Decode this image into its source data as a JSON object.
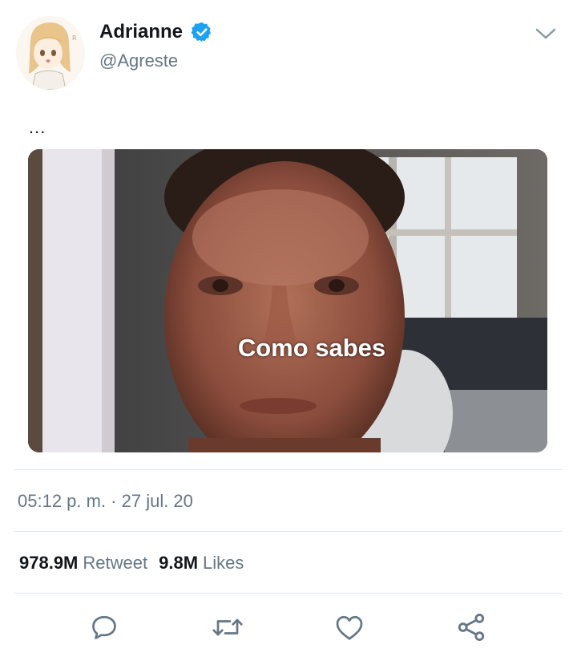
{
  "author": {
    "display_name": "Adrianne",
    "handle": "@Agreste",
    "verified": true,
    "avatar_icon": "anime-girl-avatar"
  },
  "tweet": {
    "text": "...",
    "media_caption": "Como sabes",
    "timestamp": "05:12 p. m. · 27 jul. 20"
  },
  "stats": {
    "retweets_count": "978.9M",
    "retweets_label": "Retweet",
    "likes_count": "9.8M",
    "likes_label": "Likes"
  },
  "actions": [
    "reply-icon",
    "retweet-icon",
    "like-icon",
    "share-icon"
  ],
  "colors": {
    "text_primary": "#14171a",
    "text_secondary": "#657786",
    "verified_blue": "#1da1f2",
    "divider": "#e1e8ed"
  }
}
